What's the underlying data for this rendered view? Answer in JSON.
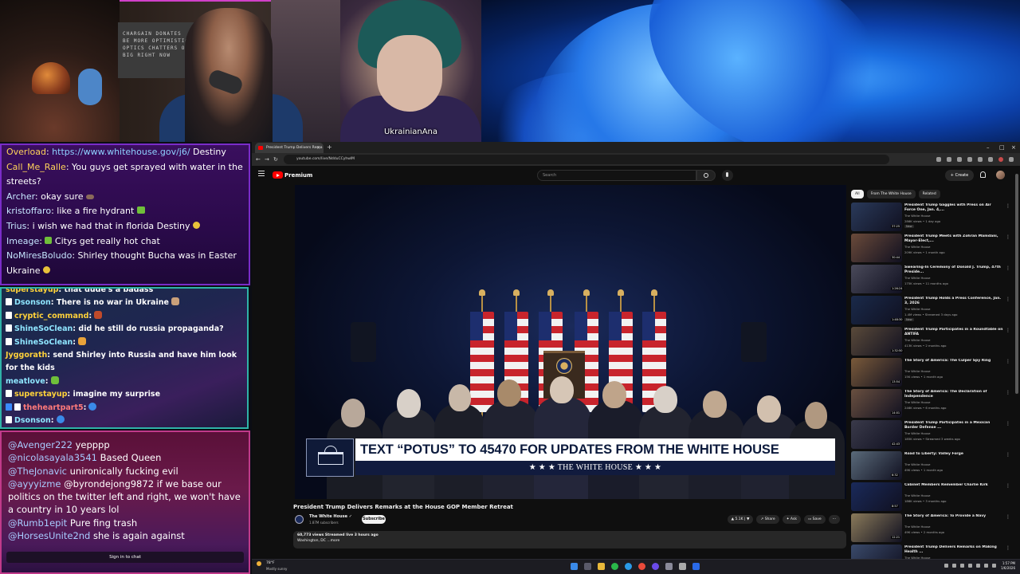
{
  "webcam": {
    "poster_lines": [
      "CHARGAIN DONATES",
      "BE MORE OPTIMISTIC",
      "OPTICS CHATTERS OF",
      "BIG RIGHT NOW"
    ]
  },
  "clip": {
    "caption": "UkrainianAna"
  },
  "chat_top": {
    "messages": [
      {
        "user": "Overload",
        "text": "https://www.whitehouse.gov/j6/",
        "suffix": " Destiny"
      },
      {
        "user": "Call_Me_Ralle",
        "text": "You guys get sprayed with water in the streets?"
      },
      {
        "user": "Archer",
        "text": "okay sure"
      },
      {
        "user": "kristoffaro",
        "text": "like a fire hydrant"
      },
      {
        "user": "Trius",
        "text": "i wish we had that in florida Destiny"
      },
      {
        "user": "Imeage",
        "text": "Citys get really hot chat"
      },
      {
        "user": "NoMiresBoludo",
        "text": "Shirley thought Bucha was in Easter Ukraine"
      }
    ]
  },
  "chat_mid": {
    "messages": [
      {
        "user": "superstayup",
        "text": "that dude's a badass"
      },
      {
        "user": "Dsonson",
        "text": "There is no war in Ukraine"
      },
      {
        "user": "cryptic_command",
        "text": ""
      },
      {
        "user": "ShineSoClean",
        "text": "did he still do russia propaganda?"
      },
      {
        "user": "ShineSoClean",
        "text": ""
      },
      {
        "user": "Jyggorath",
        "text": "send Shirley into Russia and have him look for the kids"
      },
      {
        "user": "meatlove",
        "text": ""
      },
      {
        "user": "superstayup",
        "text": "imagine my surprise"
      },
      {
        "user": "theheartpart5",
        "text": ""
      },
      {
        "user": "Dsonson",
        "text": ""
      }
    ]
  },
  "chat_bottom": {
    "messages": [
      {
        "user": "@Avenger222",
        "text": "yepppp"
      },
      {
        "user": "@nicolasayala3541",
        "text": "Based Queen"
      },
      {
        "user": "@TheJonavic",
        "text": "unironically fucking evil"
      },
      {
        "user": "@ayyyizme",
        "text": "@byrondejong9872 if we base our politics on the twitter left and right, we won't have a country in 10 years lol"
      },
      {
        "user": "@Rumb1epit",
        "text": "Pure fing trash"
      },
      {
        "user": "@HorsesUnite2nd",
        "text": "she is again against"
      }
    ],
    "signin_label": "Sign in to chat"
  },
  "browser": {
    "tab_title": "President Trump Delivers Rema",
    "url": "youtube.com/live/NdduCCyhwlM",
    "brand": "Premium",
    "search_placeholder": "Search",
    "create_label": "Create"
  },
  "video": {
    "banner_top": "TEXT “POTUS” TO 45470 FOR UPDATES FROM THE WHITE HOUSE",
    "banner_bottom": "★ ★ ★   THE WHITE HOUSE   ★ ★ ★",
    "title": "President Trump Delivers Remarks at the House GOP Member Retreat",
    "channel": "The White House",
    "subscribers": "1.87M subscribers",
    "subscribe_label": "Subscribe",
    "likes": "5.1K",
    "share_label": "Share",
    "ask_label": "Ask",
    "save_label": "Save",
    "desc_stats": "60,773 views  Streamed live 3 hours ago",
    "desc_text": "Washington, DC ...more"
  },
  "sidebar": {
    "chips": [
      "All",
      "From The White House",
      "Related"
    ],
    "items": [
      {
        "title": "President Trump Gaggles with Press on Air Force One, Jan. 4,...",
        "channel": "The White House",
        "meta": "286K views • 1 day ago",
        "duration": "37:25",
        "badge": "New",
        "color": "#2a3a5a"
      },
      {
        "title": "President Trump Meets with Zohran Mamdani, Mayor-Elect,...",
        "channel": "The White House",
        "meta": "209K views • 1 month ago",
        "duration": "30:44",
        "badge": "",
        "color": "#6a4a3a"
      },
      {
        "title": "Swearing-In Ceremony of Donald J. Trump, 47th Preside...",
        "channel": "The White House",
        "meta": "175K views • 11 months ago",
        "duration": "1:26:24",
        "badge": "",
        "color": "#4a4a5a"
      },
      {
        "title": "President Trump Holds a Press Conference, Jan. 3, 2026",
        "channel": "The White House",
        "meta": "1.4M views • Streamed 3 days ago",
        "duration": "1:48:30",
        "badge": "New",
        "color": "#1a2a4a"
      },
      {
        "title": "President Trump Participates in a Roundtable on ANTIFA",
        "channel": "The White House",
        "meta": "413K views • 2 months ago",
        "duration": "1:32:50",
        "badge": "",
        "color": "#5a4a3a"
      },
      {
        "title": "The Story of America: The Culper Spy Ring",
        "channel": "The White House",
        "meta": "15K views • 1 month ago",
        "duration": "13:54",
        "badge": "",
        "color": "#7a5a3a"
      },
      {
        "title": "The Story of America: The Declaration of Independence",
        "channel": "The White House",
        "meta": "246K views • 6 months ago",
        "duration": "14:01",
        "badge": "",
        "color": "#6a5040"
      },
      {
        "title": "President Trump Participates in a Mexican Border Defense ...",
        "channel": "The White House",
        "meta": "185K views • Streamed 3 weeks ago",
        "duration": "42:43",
        "badge": "",
        "color": "#3a3a4a"
      },
      {
        "title": "Road to Liberty: Valley Forge",
        "channel": "The White House",
        "meta": "49K views • 1 month ago",
        "duration": "6:32",
        "badge": "",
        "color": "#5a6a7a"
      },
      {
        "title": "Cabinet Members Remember Charlie Kirk",
        "channel": "The White House",
        "meta": "186K views • 3 months ago",
        "duration": "8:57",
        "badge": "",
        "color": "#1a2a5a"
      },
      {
        "title": "The Story of America: To Provide a Navy",
        "channel": "The White House",
        "meta": "49K views • 2 months ago",
        "duration": "12:21",
        "badge": "",
        "color": "#8a7a5a"
      },
      {
        "title": "President Trump Delivers Remarks on Making Health ...",
        "channel": "The White House",
        "meta": "",
        "duration": "",
        "badge": "",
        "color": "#3a4a6a"
      }
    ]
  },
  "taskbar": {
    "temp": "78°F",
    "condition": "Mostly sunny",
    "time": "1:57 PM",
    "date": "1/6/2026"
  }
}
